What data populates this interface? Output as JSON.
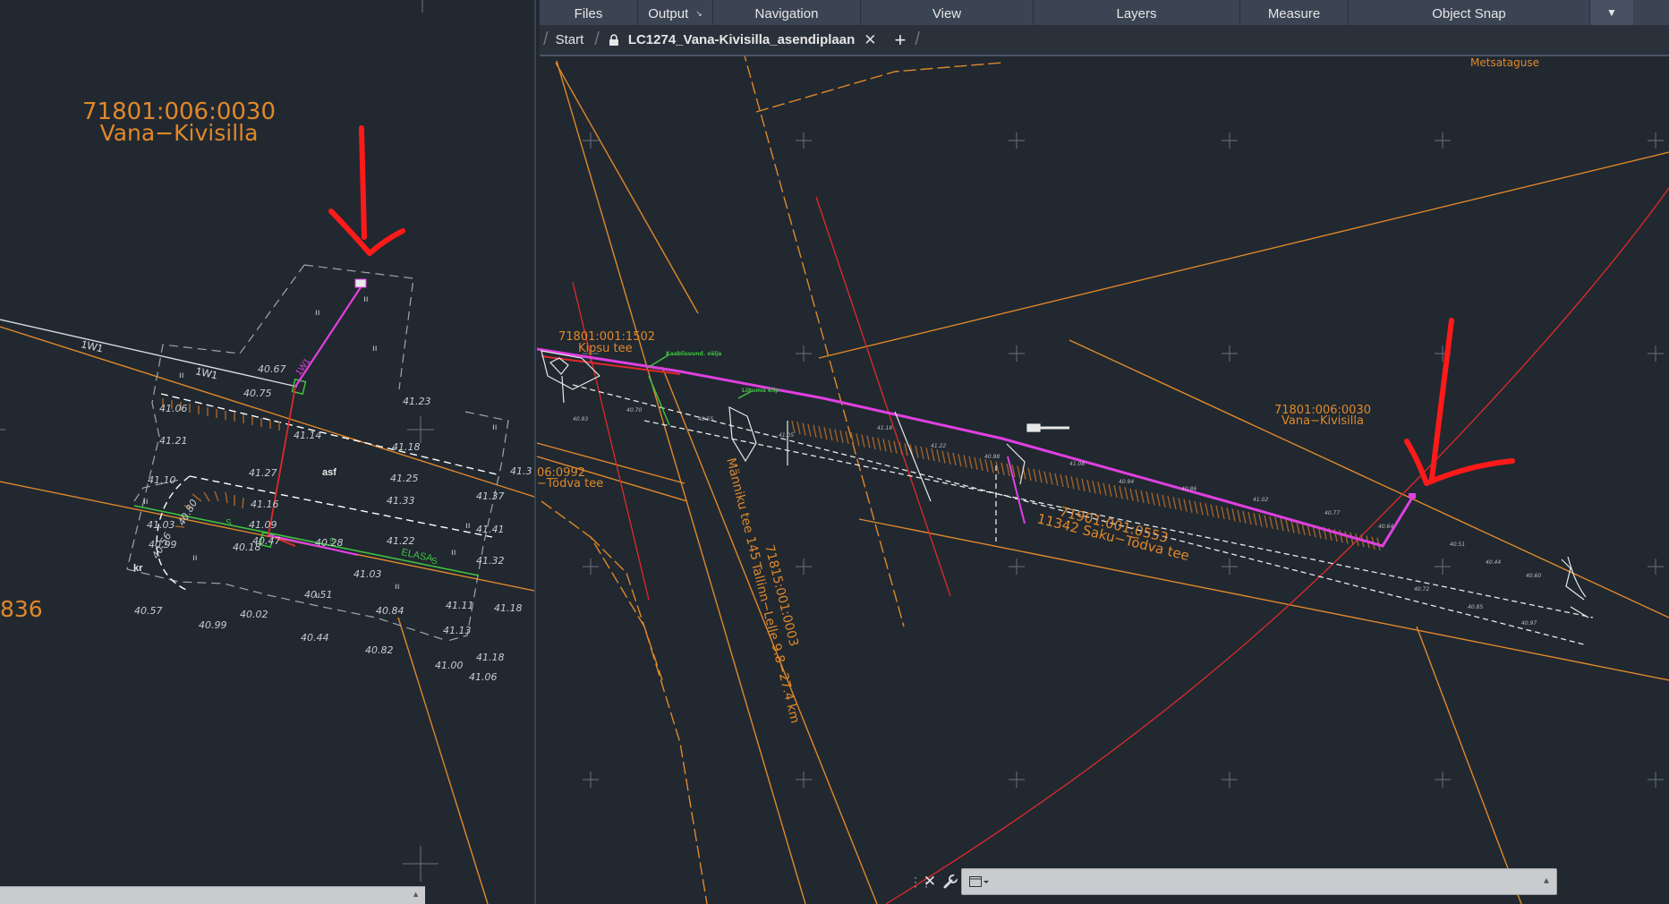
{
  "ribbon": {
    "tabs": [
      {
        "label": "Files",
        "width": 110
      },
      {
        "label": "Output",
        "width": 84,
        "arrow": "↘"
      },
      {
        "label": "Navigation",
        "width": 165
      },
      {
        "label": "View",
        "width": 193
      },
      {
        "label": "Layers",
        "width": 231
      },
      {
        "label": "Measure",
        "width": 121
      },
      {
        "label": "Object Snap",
        "width": 270
      }
    ],
    "dropdown_icon": "▼"
  },
  "tabs": {
    "start_label": "Start",
    "document_label": "LC1274_Vana-Kivisilla_asendiplaan",
    "close_glyph": "✕",
    "add_glyph": "+"
  },
  "left_view": {
    "parcel_id": "71801:006:0030",
    "parcel_name": "Vana−Kivisilla",
    "partial_number": "836",
    "labels": {
      "w1a": "1W1",
      "w1b": "1W1",
      "w1c": "1W1",
      "asf": "asf",
      "kr": "kr",
      "elasa": "ELASA",
      "s1": "S",
      "s2": "S",
      "s3": "S"
    },
    "elevations": [
      "40.67",
      "40.75",
      "41.23",
      "41.06",
      "41.21",
      "41.14",
      "41.18",
      "41.10",
      "41.27",
      "41.25",
      "41.3",
      "41.16",
      "41.33",
      "41.37",
      "41.03",
      "41.09",
      "40.80",
      "40.47",
      "41.22",
      "40.99",
      "41.41",
      "40.56",
      "40.18",
      "40.28",
      "41.03",
      "41.32",
      "40.51",
      "40.84",
      "41.11",
      "41.18",
      "40.57",
      "40.02",
      "40.99",
      "41.13",
      "40.44",
      "40.82",
      "41.18",
      "41.00",
      "41.06"
    ]
  },
  "right_view": {
    "metsataguse": "Metsataguse",
    "kipsu_id": "71801:001:1502",
    "kipsu_name": "Kipsu tee",
    "parcel_id": "71801:006:0030",
    "parcel_name": "Vana−Kivisilla",
    "todva_id": "06:0992",
    "todva_name": "−Tõdva tee",
    "saku_id": "71901:001:0553",
    "saku_name": "11342 Saku−Tõdva tee",
    "monniku": "Männiku tee 145",
    "tallinn_id": "71815:001:0003",
    "tallinn_name": "Tallinn−Lelle 9.8−27.4 km",
    "green_label_1": "Kaablisuund. välja",
    "green_label_2": "Liitumis kilp",
    "small_elevations": [
      "40.93",
      "40.70",
      "40.55",
      "41.05",
      "41.18",
      "41.22",
      "40.98",
      "41.08",
      "40.94",
      "40.86",
      "41.02",
      "40.77",
      "40.64",
      "40.51",
      "40.44",
      "40.60",
      "40.72",
      "40.85",
      "40.97"
    ]
  },
  "command_line": {
    "value": "",
    "history_icon": "▲"
  },
  "colors": {
    "background": "#212830",
    "orange": "#e0882a",
    "red": "#e02a2a",
    "magenta": "#e040e0",
    "green": "#40c040",
    "annotation_red": "#ff1a1a",
    "hatch": "#a0622a"
  }
}
